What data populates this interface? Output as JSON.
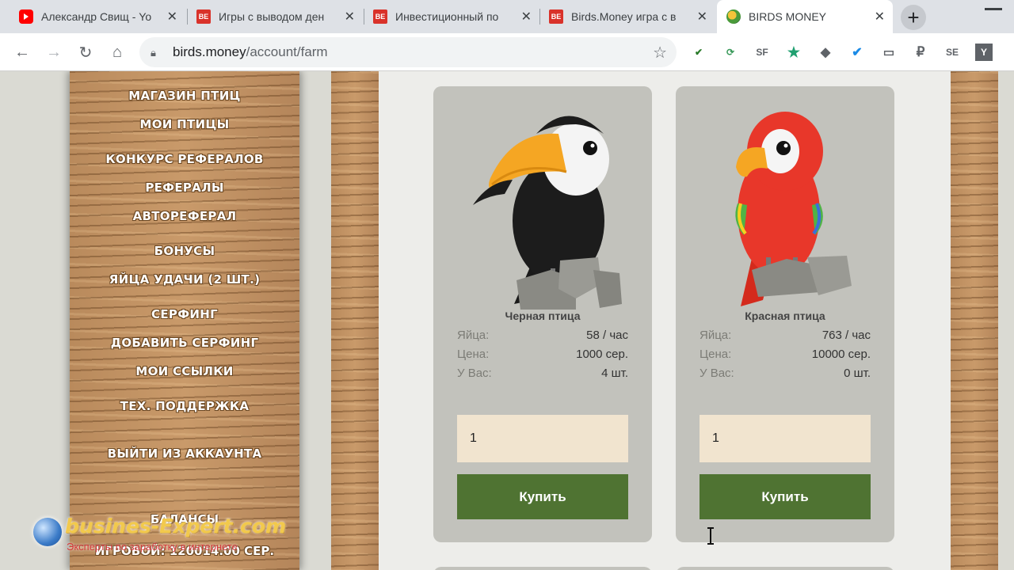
{
  "browser": {
    "tabs": [
      {
        "title": "Александр Свищ - Yo",
        "icon": "youtube-icon"
      },
      {
        "title": "Игры с выводом ден",
        "icon": "be-icon"
      },
      {
        "title": "Инвестиционный по",
        "icon": "be-icon"
      },
      {
        "title": "Birds.Money игра с в",
        "icon": "be-icon"
      },
      {
        "title": "BIRDS MONEY",
        "icon": "birds-money-icon",
        "active": true
      }
    ],
    "url_host": "birds.money",
    "url_path": "/account/farm"
  },
  "menu": {
    "items": [
      "МАГАЗИН ПТИЦ",
      "МОИ ПТИЦЫ",
      "КОНКУРС РЕФЕРАЛОВ",
      "РЕФЕРАЛЫ",
      "АВТОРЕФЕРАЛ",
      "БОНУСЫ",
      "ЯЙЦА УДАЧИ (2 ШТ.)",
      "СЕРФИНГ",
      "ДОБАВИТЬ СЕРФИНГ",
      "МОИ ССЫЛКИ",
      "ТЕХ. ПОДДЕРЖКА",
      "ВЫЙТИ ИЗ АККАУНТА"
    ],
    "balance_label": "БАЛАНСЫ",
    "balance_game": "ИГРОВОЙ: 120014.00 СЕР."
  },
  "labels": {
    "eggs": "Яйца:",
    "price": "Цена:",
    "owned": "У Вас:",
    "buy": "Купить"
  },
  "birds": [
    {
      "name": "Черная птица",
      "eggs": "58 / час",
      "price": "1000 сер.",
      "owned": "4 шт.",
      "qty": "1"
    },
    {
      "name": "Красная птица",
      "eggs": "763 / час",
      "price": "10000 сер.",
      "owned": "0 шт.",
      "qty": "1"
    }
  ],
  "watermark": {
    "title": "busines-Expert.com",
    "subtitle": "Эксперты по заработку в интернете"
  }
}
